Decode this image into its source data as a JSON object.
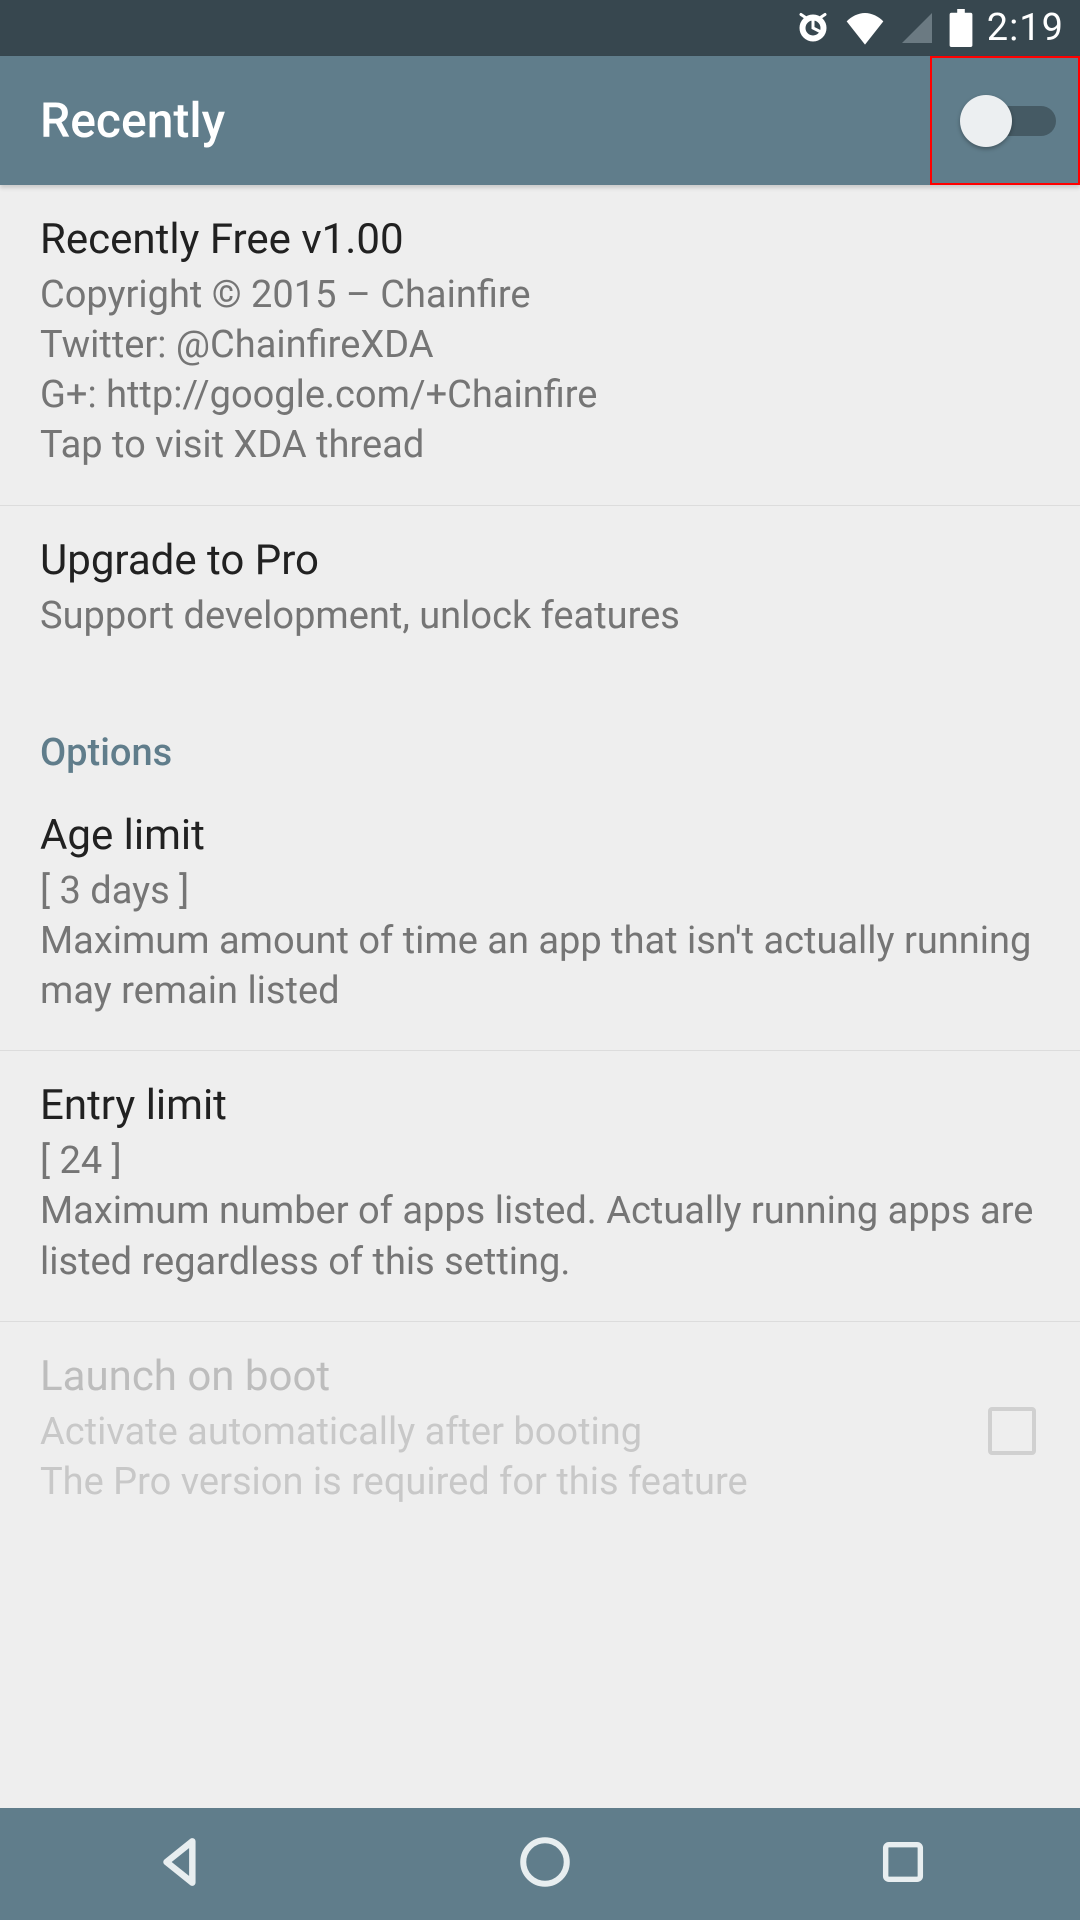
{
  "status": {
    "time": "2:19"
  },
  "appbar": {
    "title": "Recently",
    "toggle_on": false
  },
  "about": {
    "title": "Recently Free v1.00",
    "line1": "Copyright © 2015 – Chainfire",
    "line2": "Twitter: @ChainfireXDA",
    "line3": "G+: http://google.com/+Chainfire",
    "line4": "Tap to visit XDA thread"
  },
  "upgrade": {
    "title": "Upgrade to Pro",
    "sub": "Support development, unlock features"
  },
  "section_options": "Options",
  "age_limit": {
    "title": "Age limit",
    "value": "[ 3 days ]",
    "desc": "Maximum amount of time an app that isn't actually running may remain listed"
  },
  "entry_limit": {
    "title": "Entry limit",
    "value": "[ 24 ]",
    "desc": "Maximum number of apps listed. Actually running apps are listed regardless of this setting."
  },
  "launch_boot": {
    "title": "Launch on boot",
    "line1": "Activate automatically after booting",
    "line2": "The Pro version is required for this feature"
  }
}
